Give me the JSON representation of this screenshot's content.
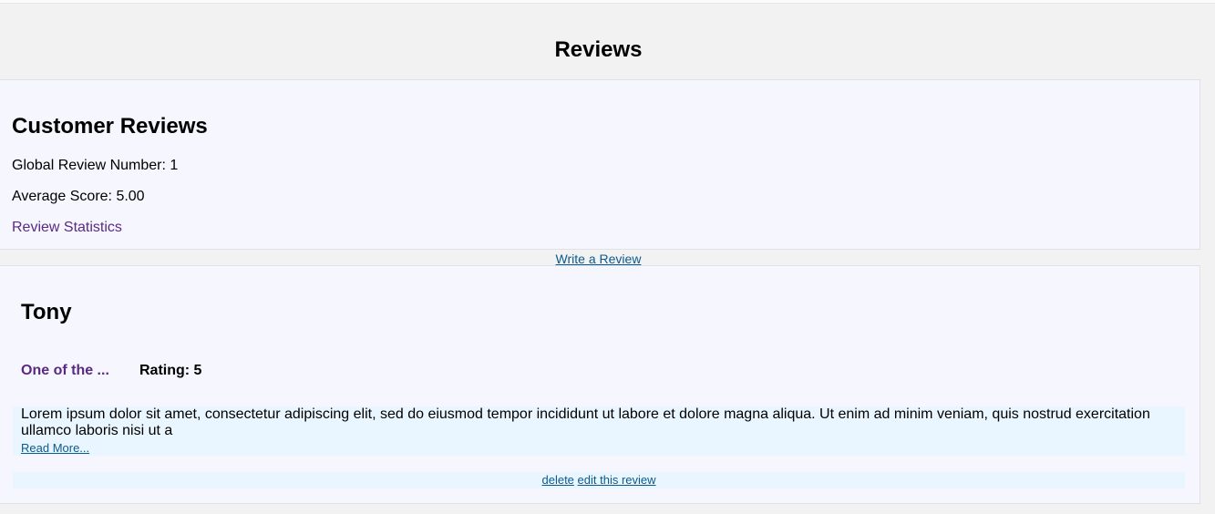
{
  "page": {
    "title": "Reviews"
  },
  "summary": {
    "heading": "Customer Reviews",
    "global_review_number": "Global Review Number: 1",
    "average_score": "Average Score: 5.00",
    "stats_link": "Review Statistics"
  },
  "write_review_link": "Write a Review",
  "reviews": [
    {
      "name": "Tony",
      "title": "One of the ...",
      "rating": "Rating: 5",
      "text": "Lorem ipsum dolor sit amet, consectetur adipiscing elit, sed do eiusmod tempor incididunt ut labore et dolore magna aliqua. Ut enim ad minim veniam, quis nostrud exercitation ullamco laboris nisi ut a",
      "read_more": "Read More...",
      "delete_label": "delete",
      "edit_label": "edit this review"
    }
  ],
  "colors": {
    "background": "#f2f2f2",
    "card": "#f6f6fe",
    "highlight": "#eaf6ff",
    "accent_purple": "#5a2a82",
    "link_blue": "#0a5a8c"
  }
}
